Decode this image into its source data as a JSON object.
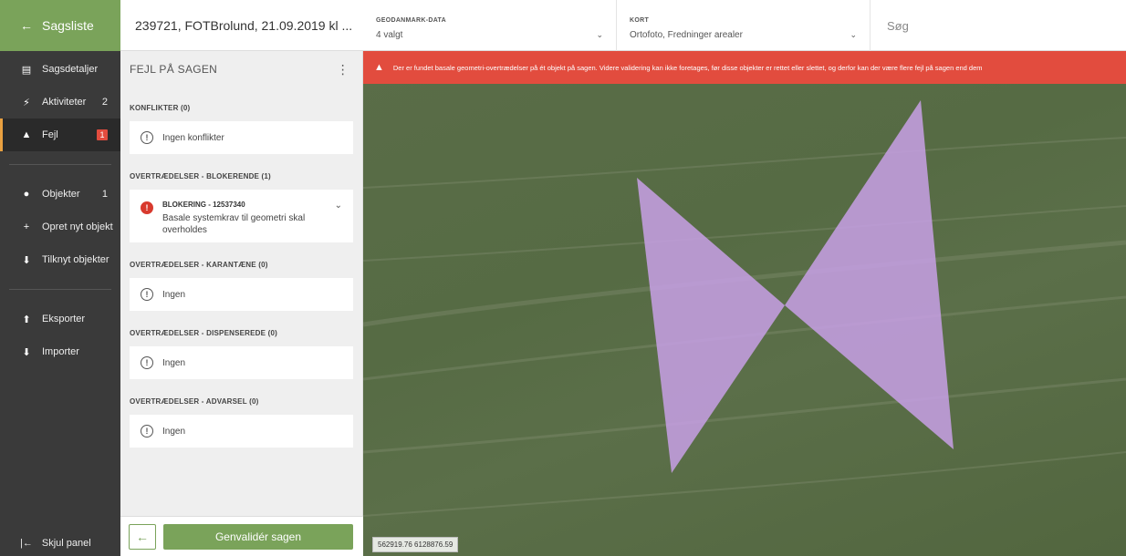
{
  "nav": {
    "back_label": "Sagsliste",
    "items": [
      {
        "label": "Sagsdetaljer",
        "icon": "clipboard-icon",
        "glyph": "▤"
      },
      {
        "label": "Aktiviteter",
        "count": "2",
        "icon": "activity-icon",
        "glyph": "⚡"
      },
      {
        "label": "Fejl",
        "badge": "1",
        "icon": "warning-triangle-icon",
        "glyph": "▲"
      },
      {
        "label": "Objekter",
        "count": "1",
        "icon": "map-pin-icon",
        "glyph": "●"
      },
      {
        "label": "Opret nyt objekt",
        "icon": "add-circle-icon",
        "glyph": "+"
      },
      {
        "label": "Tilknyt objekter",
        "icon": "link-down-icon",
        "glyph": "⬇"
      },
      {
        "label": "Eksporter",
        "icon": "export-icon",
        "glyph": "⬆"
      },
      {
        "label": "Importer",
        "icon": "import-icon",
        "glyph": "⬇"
      }
    ],
    "hide_panel": "Skjul panel"
  },
  "title": "239721, FOTBrolund, 21.09.2019 kl ...",
  "panel": {
    "heading": "FEJL PÅ SAGEN",
    "sections": [
      {
        "title": "KONFLIKTER (0)",
        "text": "Ingen konflikter"
      },
      {
        "title": "OVERTRÆDELSER - BLOKERENDE (1)",
        "block_title": "BLOKERING - 12537340",
        "block_desc": "Basale systemkrav til geometri skal overholdes"
      },
      {
        "title": "OVERTRÆDELSER - KARANTÆNE (0)",
        "text": "Ingen"
      },
      {
        "title": "OVERTRÆDELSER - DISPENSEREDE (0)",
        "text": "Ingen"
      },
      {
        "title": "OVERTRÆDELSER - ADVARSEL (0)",
        "text": "Ingen"
      }
    ],
    "revalidate_label": "Genvalidér sagen"
  },
  "toolbar": {
    "geodata_label": "GEODANMARK-DATA",
    "geodata_value": "4 valgt",
    "kort_label": "KORT",
    "kort_value": "Ortofoto, Fredninger arealer",
    "search_placeholder": "Søg"
  },
  "map": {
    "alert": "Der er fundet basale geometri-overtrædelser på ét objekt på sagen. Videre validering kan ikke foretages, før disse objekter er rettet eller slettet, og derfor kan der være flere fejl på sagen end dem",
    "coordinates": "562919.76 6128876.59",
    "polygon_color": "#c8a0e6"
  },
  "colors": {
    "accent": "#7aa35a",
    "alert": "#e24c3e",
    "nav_bg": "#3a3a3a"
  }
}
